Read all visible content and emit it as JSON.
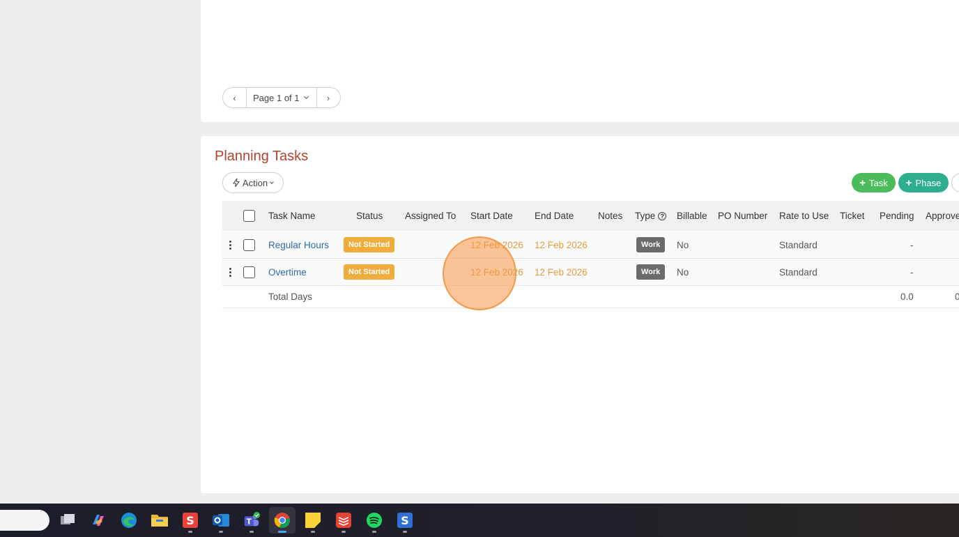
{
  "pagination": {
    "prev_icon": "chevron-left",
    "page_label": "Page 1 of 1",
    "next_icon": "chevron-right"
  },
  "section": {
    "title": "Planning Tasks"
  },
  "toolbar": {
    "action_label": "Action",
    "task_label": "Task",
    "phase_label": "Phase"
  },
  "table": {
    "headers": {
      "task_name": "Task Name",
      "status": "Status",
      "assigned_to": "Assigned To",
      "start_date": "Start Date",
      "end_date": "End Date",
      "notes": "Notes",
      "type": "Type",
      "billable": "Billable",
      "po_number": "PO Number",
      "rate": "Rate to Use",
      "ticket": "Ticket",
      "pending": "Pending",
      "approved": "Approve"
    },
    "rows": [
      {
        "task_name": "Regular Hours",
        "status": "Not Started",
        "start_date": "12 Feb 2026",
        "end_date": "12 Feb 2026",
        "type": "Work",
        "billable": "No",
        "rate": "Standard",
        "pending": "-"
      },
      {
        "task_name": "Overtime",
        "status": "Not Started",
        "start_date": "12 Feb 2026",
        "end_date": "12 Feb 2026",
        "type": "Work",
        "billable": "No",
        "rate": "Standard",
        "pending": "-"
      }
    ],
    "total": {
      "label": "Total Days",
      "pending": "0.0",
      "approved": "0"
    }
  },
  "colors": {
    "title": "#b5412f",
    "task_button": "#4cbb5c",
    "phase_button": "#2fae8e",
    "status_badge": "#f0ad3c",
    "date_text": "#e59a3c",
    "link": "#2e6ba8"
  },
  "taskbar": {
    "apps": [
      "task-view-icon",
      "copilot-icon",
      "edge-icon",
      "file-explorer-icon",
      "wps-icon",
      "outlook-icon",
      "teams-icon",
      "chrome-icon",
      "sticky-notes-icon",
      "todoist-icon",
      "spotify-icon",
      "app-s-icon"
    ],
    "active_app": "chrome-icon"
  }
}
